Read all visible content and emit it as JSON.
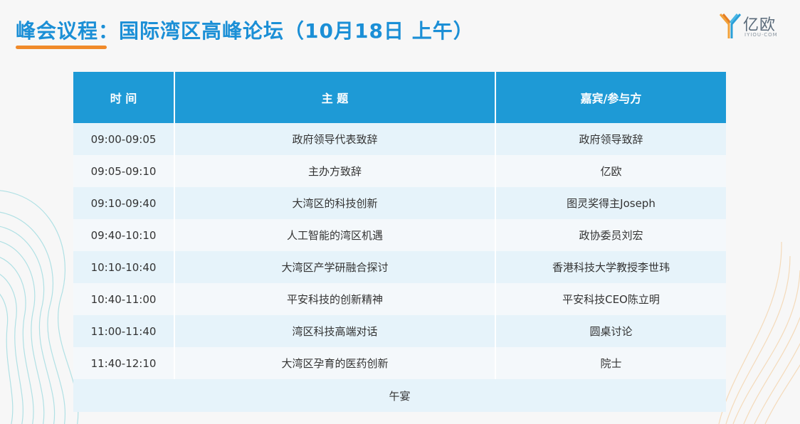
{
  "title": {
    "prefix": "峰会议程",
    "rest": "：国际湾区高峰论坛（10月18日 上午）"
  },
  "logo": {
    "word": "亿欧",
    "sub": "IYIOU·COM"
  },
  "table": {
    "headers": [
      "时 间",
      "主 题",
      "嘉宾/参与方"
    ],
    "rows": [
      [
        "09:00-09:05",
        "政府领导代表致辞",
        "政府领导致辞"
      ],
      [
        "09:05-09:10",
        "主办方致辞",
        "亿欧"
      ],
      [
        "09:10-09:40",
        "大湾区的科技创新",
        "图灵奖得主Joseph"
      ],
      [
        "09:40-10:10",
        "人工智能的湾区机遇",
        "政协委员刘宏"
      ],
      [
        "10:10-10:40",
        "大湾区产学研融合探讨",
        "香港科技大学教授李世玮"
      ],
      [
        "10:40-11:00",
        "平安科技的创新精神",
        "平安科技CEO陈立明"
      ],
      [
        "11:00-11:40",
        "湾区科技高端对话",
        "圆桌讨论"
      ],
      [
        "11:40-12:10",
        "大湾区孕育的医药创新",
        "院士"
      ]
    ],
    "footer": "午宴"
  },
  "colors": {
    "header_bg": "#1e9ad6",
    "title": "#1b8fd6",
    "underline": "#f08a2a"
  }
}
